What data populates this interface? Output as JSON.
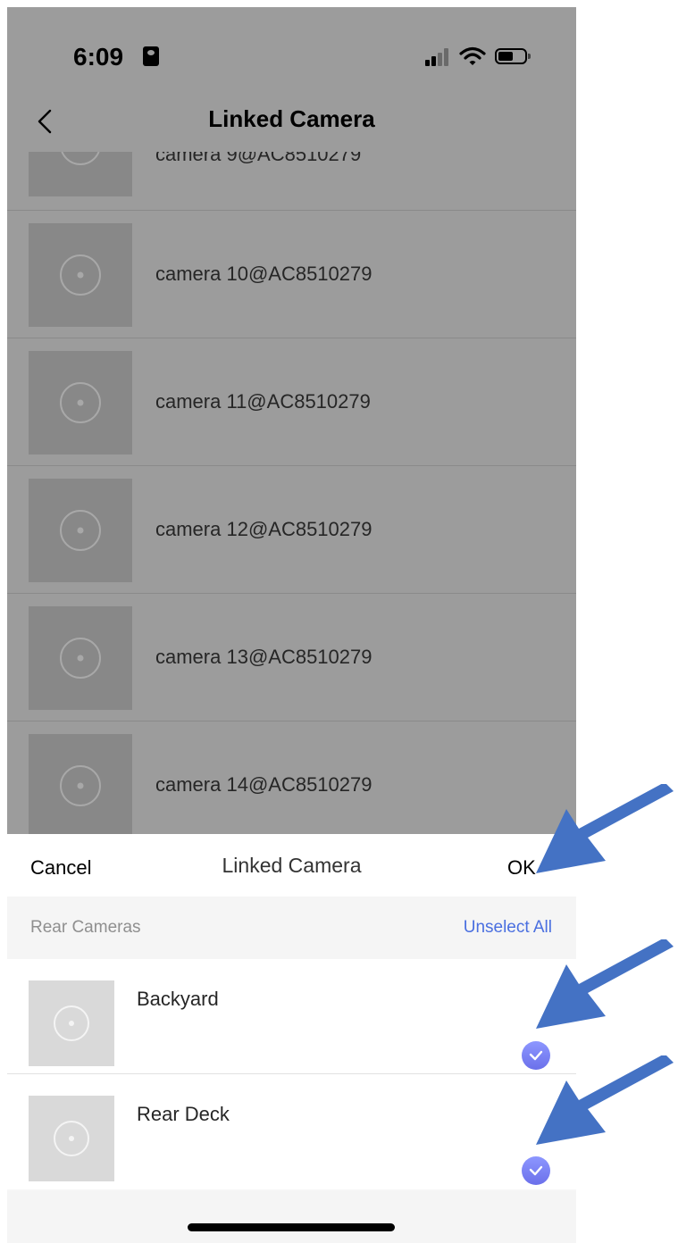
{
  "status_bar": {
    "time": "6:09",
    "icons": [
      "person-badge-icon",
      "signal-icon",
      "wifi-icon",
      "battery-icon"
    ]
  },
  "nav": {
    "title": "Linked Camera",
    "back_icon": "chevron-left-icon"
  },
  "background_list": [
    {
      "label": "camera 9@AC8510279"
    },
    {
      "label": "camera 10@AC8510279"
    },
    {
      "label": "camera 11@AC8510279"
    },
    {
      "label": "camera 12@AC8510279"
    },
    {
      "label": "camera 13@AC8510279"
    },
    {
      "label": "camera 14@AC8510279"
    }
  ],
  "sheet": {
    "cancel_label": "Cancel",
    "title": "Linked Camera",
    "ok_label": "OK",
    "section": {
      "title": "Rear Cameras",
      "unselect_label": "Unselect All"
    },
    "items": [
      {
        "label": "Backyard",
        "selected": true
      },
      {
        "label": "Rear Deck",
        "selected": true
      }
    ]
  },
  "colors": {
    "accent": "#4a6fe0",
    "check": "#7b82f5",
    "annotation_arrow": "#4472c4",
    "overlay": "#9c9c9c"
  },
  "annotations": [
    "arrow-icon",
    "arrow-icon",
    "arrow-icon"
  ]
}
